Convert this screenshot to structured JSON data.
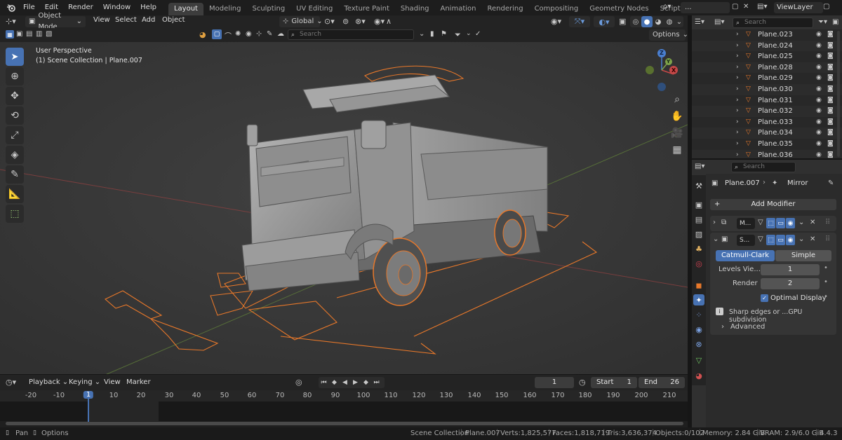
{
  "menu": {
    "app_icon": "blender-logo-icon",
    "items": [
      "File",
      "Edit",
      "Render",
      "Window",
      "Help"
    ]
  },
  "workspaces": [
    "Layout",
    "Modeling",
    "Sculpting",
    "UV Editing",
    "Texture Paint",
    "Shading",
    "Animation",
    "Rendering",
    "Compositing",
    "Geometry Nodes",
    "Scripting",
    "+"
  ],
  "active_workspace": "Layout",
  "top_right": {
    "scene_value": "...",
    "view_layer": "ViewLayer"
  },
  "viewport_header": {
    "mode": "Object Mode",
    "menus": [
      "View",
      "Select",
      "Add",
      "Object"
    ],
    "orientation": "Global",
    "options": "Options",
    "search_placeholder": "Search"
  },
  "viewport": {
    "perspective": "User Perspective",
    "collection_info": "(1) Scene Collection | Plane.007",
    "gizmo": {
      "z": "Z",
      "y": "Y",
      "x": "X"
    }
  },
  "outliner": {
    "search_placeholder": "Search",
    "items": [
      "Plane.023",
      "Plane.024",
      "Plane.025",
      "Plane.028",
      "Plane.029",
      "Plane.030",
      "Plane.031",
      "Plane.032",
      "Plane.033",
      "Plane.034",
      "Plane.035",
      "Plane.036"
    ]
  },
  "properties": {
    "search_placeholder": "Search",
    "breadcrumb_object": "Plane.007",
    "breadcrumb_modifier": "Mirror",
    "add_modifier": "Add Modifier",
    "modifiers": [
      {
        "short_name": "M...",
        "expanded": false
      },
      {
        "short_name": "S...",
        "expanded": true
      }
    ],
    "subdiv_types": [
      "Catmull-Clark",
      "Simple"
    ],
    "levels_viewport_label": "Levels Vie...",
    "levels_viewport_value": "1",
    "render_label": "Render",
    "render_value": "2",
    "optimal_display": "Optimal Display",
    "optimal_display_checked": true,
    "info_text": "Sharp edges or ...GPU subdivision",
    "advanced": "Advanced"
  },
  "timeline": {
    "menus": [
      "Playback",
      "Keying",
      "View",
      "Marker"
    ],
    "current_frame": "1",
    "start_label": "Start",
    "start_value": "1",
    "end_label": "End",
    "end_value": "26",
    "ruler": [
      "-20",
      "-10",
      "1",
      "10",
      "20",
      "30",
      "40",
      "50",
      "60",
      "70",
      "80",
      "90",
      "100",
      "110",
      "120",
      "130",
      "140",
      "150",
      "160",
      "170",
      "180",
      "190",
      "200",
      "210"
    ]
  },
  "status": {
    "pan": "Pan",
    "options": "Options",
    "scene": "Scene Collection",
    "object": "Plane.007",
    "verts": "Verts:1,825,577",
    "faces": "Faces:1,818,719",
    "tris": "Tris:3,636,374",
    "objects": "Objects:0/102",
    "memory": "Memory: 2.84 GiB",
    "vram": "VRAM: 2.9/6.0 GiB",
    "version": "4.4.3"
  },
  "colors": {
    "accent": "#4772b3",
    "selection_orange": "#e8782a",
    "axis_red": "#c44848",
    "axis_green": "#7ea34a",
    "axis_blue": "#4a7fd0"
  }
}
